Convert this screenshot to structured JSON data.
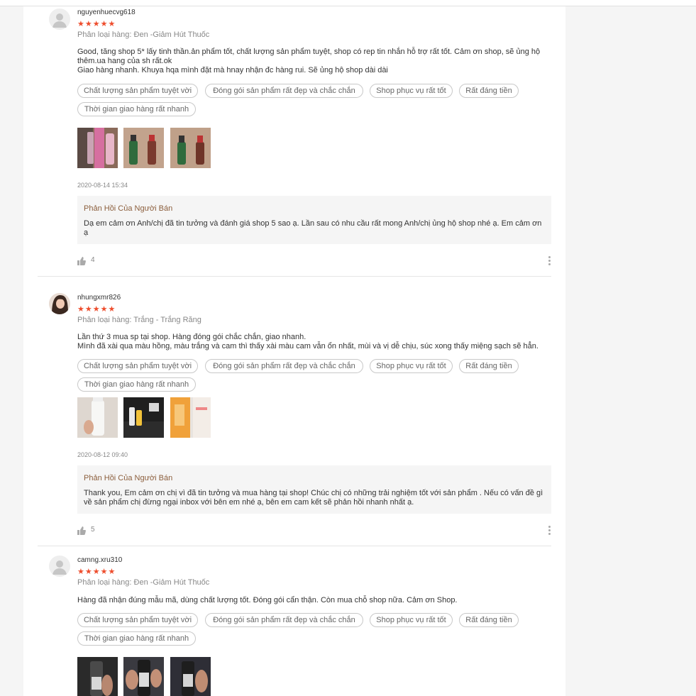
{
  "reviews": [
    {
      "username": "nguyenhuecvg618",
      "stars": "★★★★★",
      "variation": "Phân loại hàng: Đen -Giảm Hút Thuốc",
      "comment": "Good, tăng shop 5* lấy tinh thần.ản phẩm tốt, chất lượng sản phẩm tuyệt, shop có rep tin nhắn hỗ trợ rất tốt. Cảm ơn shop, sẽ ủng hộ thêm.ua hang của sh rất.ok\nGiao hàng nhanh. Khuya hqa mình đặt mà hnay nhận đc hàng rui. Sẽ ủng hộ shop dài dài",
      "tags": [
        "Chất lượng sản phẩm tuyệt vời",
        "Đóng gói sản phẩm rất đẹp và chắc chắn",
        "Shop phục vụ rất tốt",
        "Rất đáng tiền",
        "Thời gian giao hàng rất nhanh"
      ],
      "timestamp": "2020-08-14 15:34",
      "reply_title": "Phản Hồi Của Người Bán",
      "reply_text": "Dạ em cảm ơn Anh/chị đã tin tưởng và đánh giá shop 5 sao ạ. Lần sau có nhu cầu rất mong Anh/chị ủng hộ shop nhé ạ. Em cảm ơn ạ",
      "likes": "4"
    },
    {
      "username": "nhungxmr826",
      "stars": "★★★★★",
      "variation": "Phân loại hàng: Trắng - Trắng Răng",
      "comment": "Lần thứ 3 mua sp tại shop. Hàng đóng gói chắc chắn, giao nhanh.\nMình đã xài qua màu hồng, màu trắng và cam thì thấy xài màu cam vẫn ổn nhất, mùi và vị dễ chịu, súc xong thấy miệng sạch sẽ hẳn.",
      "tags": [
        "Chất lượng sản phẩm tuyệt vời",
        "Đóng gói sản phẩm rất đẹp và chắc chắn",
        "Shop phục vụ rất tốt",
        "Rất đáng tiền",
        "Thời gian giao hàng rất nhanh"
      ],
      "timestamp": "2020-08-12 09:40",
      "reply_title": "Phản Hồi Của Người Bán",
      "reply_text": "Thank you, Em cảm ơn chị vì đã tin tưởng và mua hàng tại shop! Chúc chị có những trải nghiệm tốt với sản phẩm . Nếu có vấn đề gì về sản phẩm chị đừng ngại inbox với bên em nhé ạ, bên em cam kết sẽ phản hồi nhanh nhất ạ.",
      "likes": "5"
    },
    {
      "username": "camng.xru310",
      "stars": "★★★★★",
      "variation": "Phân loại hàng: Đen -Giảm Hút Thuốc",
      "comment": "Hàng đã nhận đúng mẫu mã, dùng chất lượng tốt. Đóng gói cẩn thận. Còn mua chỗ shop nữa. Cảm ơn Shop.",
      "tags": [
        "Chất lượng sản phẩm tuyệt vời",
        "Đóng gói sản phẩm rất đẹp và chắc chắn",
        "Shop phục vụ rất tốt",
        "Rất đáng tiền",
        "Thời gian giao hàng rất nhanh"
      ]
    }
  ],
  "colors": {
    "star": "#ee4d2d",
    "reply_title": "#8b5e3c",
    "reply_bg": "#f5f5f5"
  },
  "icons": [
    "default-avatar-icon",
    "user-avatar-photo",
    "thumbs-up-icon",
    "more-options-icon"
  ]
}
